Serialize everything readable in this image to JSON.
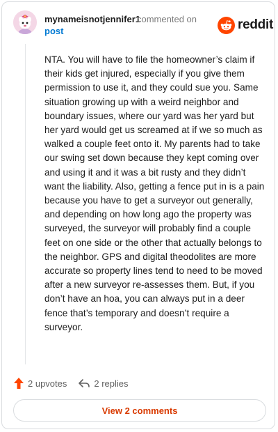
{
  "header": {
    "username": "mynameisnotjennifer1",
    "commented_on": "commented on",
    "post_link": "post",
    "brand": "reddit"
  },
  "comment": {
    "body": "NTA. You will have to file the homeowner’s claim if their kids get injured, especially if you give them permission to use it, and they could sue you. Same situation growing up with a weird neighbor and boundary issues, where our yard was her yard but her yard would get us screamed at if we so much as walked a couple feet onto it. My parents had to take our swing set down because they kept coming over and using it and it was a bit rusty and they didn’t want the liability. Also, getting a fence put in is a pain because you have to get a surveyor out generally, and depending on how long ago the property was surveyed, the surveyor will probably find a couple feet on one side or the other that actually belongs to the neighbor. GPS and digital theodolites are more accurate so property lines tend to need to be moved after a new surveyor re-assesses them. But, if you don’t have an hoa, you can always put in a deer fence that’s temporary and doesn’t require a surveyor."
  },
  "actions": {
    "upvotes": "2 upvotes",
    "replies": "2 replies",
    "upvote_icon": "upvote-arrow-icon",
    "reply_icon": "reply-arrow-icon"
  },
  "footer": {
    "view_comments": "View 2 comments"
  },
  "colors": {
    "brand_orange": "#ff4500",
    "link_blue": "#0079d3",
    "button_text": "#d93a00"
  }
}
